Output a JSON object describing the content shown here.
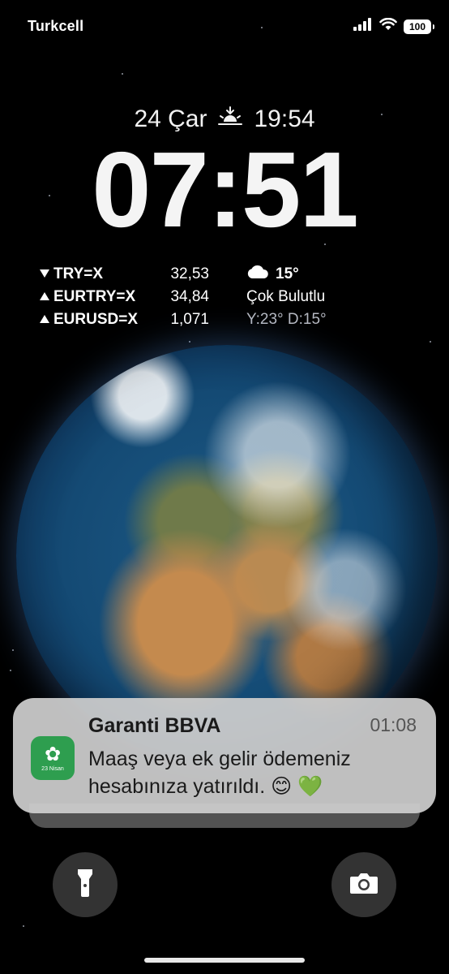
{
  "status_bar": {
    "carrier": "Turkcell",
    "battery": "100"
  },
  "lockscreen": {
    "date": "24 Çar",
    "sunset_time": "19:54",
    "time": "07:51"
  },
  "stocks": [
    {
      "direction": "down",
      "symbol": "TRY=X",
      "value": "32,53"
    },
    {
      "direction": "up",
      "symbol": "EURTRY=X",
      "value": "34,84"
    },
    {
      "direction": "up",
      "symbol": "EURUSD=X",
      "value": "1,071"
    }
  ],
  "weather": {
    "temp": "15°",
    "condition": "Çok Bulutlu",
    "range": "Y:23° D:15°"
  },
  "notification": {
    "app": "Garanti BBVA",
    "time": "01:08",
    "body_line1": "Maaş veya ek gelir ödemeniz",
    "body_line2": "hesabınıza yatırıldı. 😊 💚",
    "icon_badge": "23 Nisan",
    "icon_color": "#2e9e4f"
  },
  "icons": [
    "signal-icon",
    "wifi-icon",
    "battery-icon",
    "sunset-icon",
    "cloud-icon",
    "flashlight-icon",
    "camera-icon"
  ]
}
